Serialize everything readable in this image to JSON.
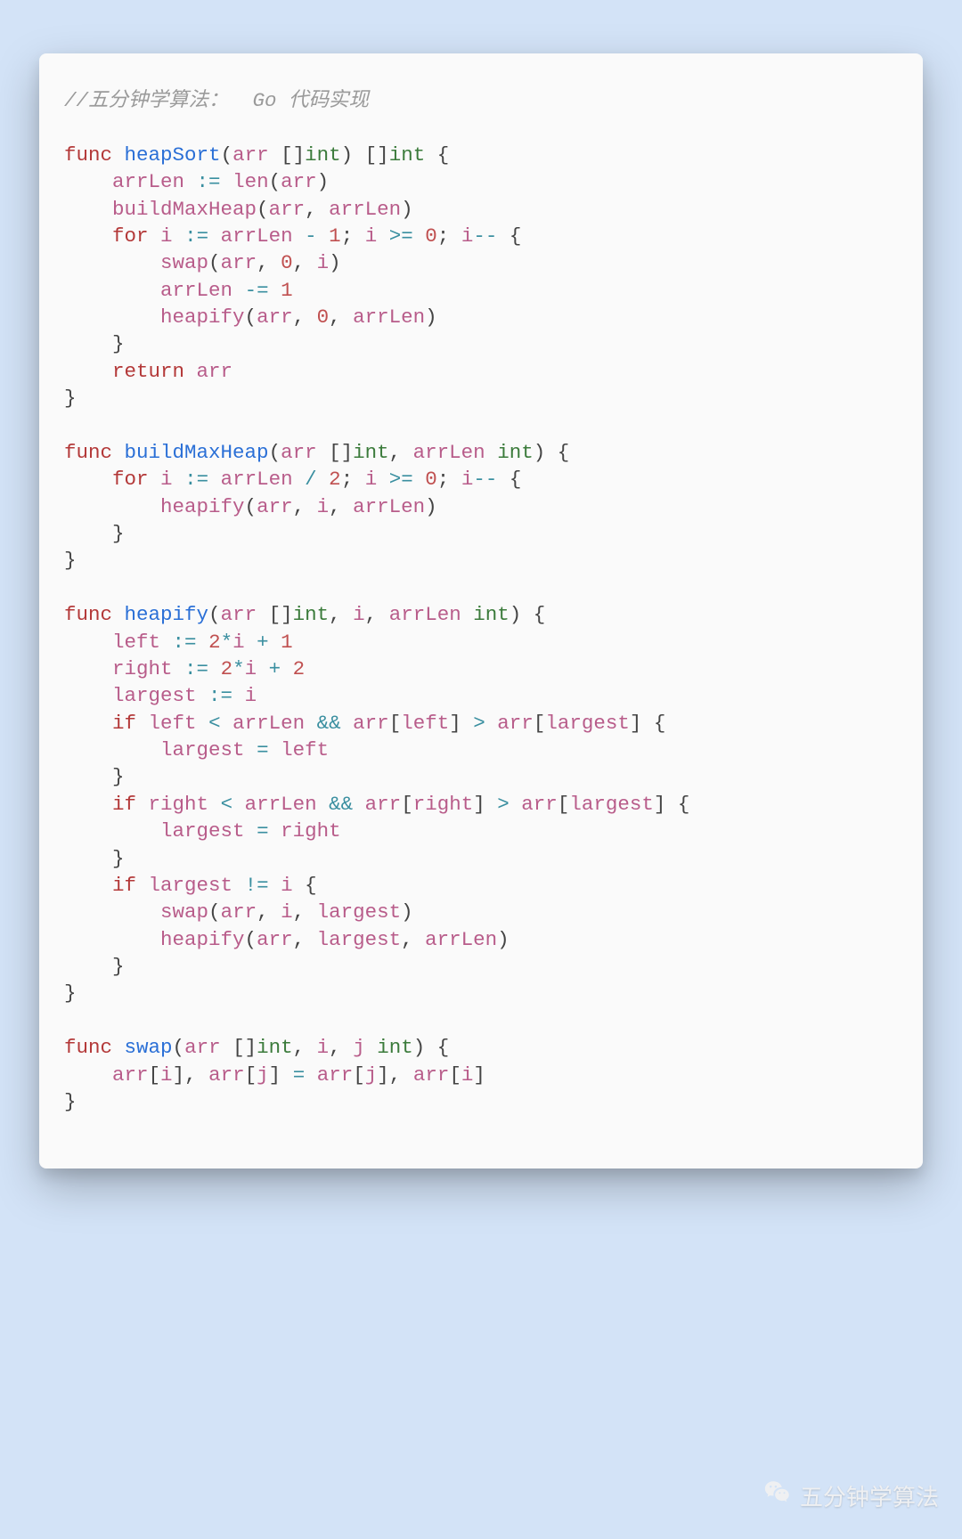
{
  "comment": "//五分钟学算法：  Go 代码实现",
  "watermark": "五分钟学算法",
  "code": {
    "language": "go",
    "tokens": [
      {
        "t": "cmt",
        "v": "//五分钟学算法：  Go 代码实现"
      },
      {
        "t": "nl"
      },
      {
        "t": "nl"
      },
      {
        "t": "kw",
        "v": "func"
      },
      {
        "t": "sp"
      },
      {
        "t": "fn",
        "v": "heapSort"
      },
      {
        "t": "pn",
        "v": "("
      },
      {
        "t": "id",
        "v": "arr"
      },
      {
        "t": "sp"
      },
      {
        "t": "pn",
        "v": "[]"
      },
      {
        "t": "typ",
        "v": "int"
      },
      {
        "t": "pn",
        "v": ")"
      },
      {
        "t": "sp"
      },
      {
        "t": "pn",
        "v": "[]"
      },
      {
        "t": "typ",
        "v": "int"
      },
      {
        "t": "sp"
      },
      {
        "t": "pn",
        "v": "{"
      },
      {
        "t": "nl"
      },
      {
        "t": "ind",
        "n": 1
      },
      {
        "t": "id",
        "v": "arrLen"
      },
      {
        "t": "sp"
      },
      {
        "t": "op",
        "v": ":="
      },
      {
        "t": "sp"
      },
      {
        "t": "id",
        "v": "len"
      },
      {
        "t": "pn",
        "v": "("
      },
      {
        "t": "id",
        "v": "arr"
      },
      {
        "t": "pn",
        "v": ")"
      },
      {
        "t": "nl"
      },
      {
        "t": "ind",
        "n": 1
      },
      {
        "t": "id",
        "v": "buildMaxHeap"
      },
      {
        "t": "pn",
        "v": "("
      },
      {
        "t": "id",
        "v": "arr"
      },
      {
        "t": "pn",
        "v": ","
      },
      {
        "t": "sp"
      },
      {
        "t": "id",
        "v": "arrLen"
      },
      {
        "t": "pn",
        "v": ")"
      },
      {
        "t": "nl"
      },
      {
        "t": "ind",
        "n": 1
      },
      {
        "t": "kw",
        "v": "for"
      },
      {
        "t": "sp"
      },
      {
        "t": "id",
        "v": "i"
      },
      {
        "t": "sp"
      },
      {
        "t": "op",
        "v": ":="
      },
      {
        "t": "sp"
      },
      {
        "t": "id",
        "v": "arrLen"
      },
      {
        "t": "sp"
      },
      {
        "t": "op",
        "v": "-"
      },
      {
        "t": "sp"
      },
      {
        "t": "num",
        "v": "1"
      },
      {
        "t": "pn",
        "v": ";"
      },
      {
        "t": "sp"
      },
      {
        "t": "id",
        "v": "i"
      },
      {
        "t": "sp"
      },
      {
        "t": "op",
        "v": ">="
      },
      {
        "t": "sp"
      },
      {
        "t": "num",
        "v": "0"
      },
      {
        "t": "pn",
        "v": ";"
      },
      {
        "t": "sp"
      },
      {
        "t": "id",
        "v": "i"
      },
      {
        "t": "op",
        "v": "--"
      },
      {
        "t": "sp"
      },
      {
        "t": "pn",
        "v": "{"
      },
      {
        "t": "nl"
      },
      {
        "t": "ind",
        "n": 2
      },
      {
        "t": "id",
        "v": "swap"
      },
      {
        "t": "pn",
        "v": "("
      },
      {
        "t": "id",
        "v": "arr"
      },
      {
        "t": "pn",
        "v": ","
      },
      {
        "t": "sp"
      },
      {
        "t": "num",
        "v": "0"
      },
      {
        "t": "pn",
        "v": ","
      },
      {
        "t": "sp"
      },
      {
        "t": "id",
        "v": "i"
      },
      {
        "t": "pn",
        "v": ")"
      },
      {
        "t": "nl"
      },
      {
        "t": "ind",
        "n": 2
      },
      {
        "t": "id",
        "v": "arrLen"
      },
      {
        "t": "sp"
      },
      {
        "t": "op",
        "v": "-="
      },
      {
        "t": "sp"
      },
      {
        "t": "num",
        "v": "1"
      },
      {
        "t": "nl"
      },
      {
        "t": "ind",
        "n": 2
      },
      {
        "t": "id",
        "v": "heapify"
      },
      {
        "t": "pn",
        "v": "("
      },
      {
        "t": "id",
        "v": "arr"
      },
      {
        "t": "pn",
        "v": ","
      },
      {
        "t": "sp"
      },
      {
        "t": "num",
        "v": "0"
      },
      {
        "t": "pn",
        "v": ","
      },
      {
        "t": "sp"
      },
      {
        "t": "id",
        "v": "arrLen"
      },
      {
        "t": "pn",
        "v": ")"
      },
      {
        "t": "nl"
      },
      {
        "t": "ind",
        "n": 1
      },
      {
        "t": "pn",
        "v": "}"
      },
      {
        "t": "nl"
      },
      {
        "t": "ind",
        "n": 1
      },
      {
        "t": "kw",
        "v": "return"
      },
      {
        "t": "sp"
      },
      {
        "t": "id",
        "v": "arr"
      },
      {
        "t": "nl"
      },
      {
        "t": "pn",
        "v": "}"
      },
      {
        "t": "nl"
      },
      {
        "t": "nl"
      },
      {
        "t": "kw",
        "v": "func"
      },
      {
        "t": "sp"
      },
      {
        "t": "fn",
        "v": "buildMaxHeap"
      },
      {
        "t": "pn",
        "v": "("
      },
      {
        "t": "id",
        "v": "arr"
      },
      {
        "t": "sp"
      },
      {
        "t": "pn",
        "v": "[]"
      },
      {
        "t": "typ",
        "v": "int"
      },
      {
        "t": "pn",
        "v": ","
      },
      {
        "t": "sp"
      },
      {
        "t": "id",
        "v": "arrLen"
      },
      {
        "t": "sp"
      },
      {
        "t": "typ",
        "v": "int"
      },
      {
        "t": "pn",
        "v": ")"
      },
      {
        "t": "sp"
      },
      {
        "t": "pn",
        "v": "{"
      },
      {
        "t": "nl"
      },
      {
        "t": "ind",
        "n": 1
      },
      {
        "t": "kw",
        "v": "for"
      },
      {
        "t": "sp"
      },
      {
        "t": "id",
        "v": "i"
      },
      {
        "t": "sp"
      },
      {
        "t": "op",
        "v": ":="
      },
      {
        "t": "sp"
      },
      {
        "t": "id",
        "v": "arrLen"
      },
      {
        "t": "sp"
      },
      {
        "t": "op",
        "v": "/"
      },
      {
        "t": "sp"
      },
      {
        "t": "num",
        "v": "2"
      },
      {
        "t": "pn",
        "v": ";"
      },
      {
        "t": "sp"
      },
      {
        "t": "id",
        "v": "i"
      },
      {
        "t": "sp"
      },
      {
        "t": "op",
        "v": ">="
      },
      {
        "t": "sp"
      },
      {
        "t": "num",
        "v": "0"
      },
      {
        "t": "pn",
        "v": ";"
      },
      {
        "t": "sp"
      },
      {
        "t": "id",
        "v": "i"
      },
      {
        "t": "op",
        "v": "--"
      },
      {
        "t": "sp"
      },
      {
        "t": "pn",
        "v": "{"
      },
      {
        "t": "nl"
      },
      {
        "t": "ind",
        "n": 2
      },
      {
        "t": "id",
        "v": "heapify"
      },
      {
        "t": "pn",
        "v": "("
      },
      {
        "t": "id",
        "v": "arr"
      },
      {
        "t": "pn",
        "v": ","
      },
      {
        "t": "sp"
      },
      {
        "t": "id",
        "v": "i"
      },
      {
        "t": "pn",
        "v": ","
      },
      {
        "t": "sp"
      },
      {
        "t": "id",
        "v": "arrLen"
      },
      {
        "t": "pn",
        "v": ")"
      },
      {
        "t": "nl"
      },
      {
        "t": "ind",
        "n": 1
      },
      {
        "t": "pn",
        "v": "}"
      },
      {
        "t": "nl"
      },
      {
        "t": "pn",
        "v": "}"
      },
      {
        "t": "nl"
      },
      {
        "t": "nl"
      },
      {
        "t": "kw",
        "v": "func"
      },
      {
        "t": "sp"
      },
      {
        "t": "fn",
        "v": "heapify"
      },
      {
        "t": "pn",
        "v": "("
      },
      {
        "t": "id",
        "v": "arr"
      },
      {
        "t": "sp"
      },
      {
        "t": "pn",
        "v": "[]"
      },
      {
        "t": "typ",
        "v": "int"
      },
      {
        "t": "pn",
        "v": ","
      },
      {
        "t": "sp"
      },
      {
        "t": "id",
        "v": "i"
      },
      {
        "t": "pn",
        "v": ","
      },
      {
        "t": "sp"
      },
      {
        "t": "id",
        "v": "arrLen"
      },
      {
        "t": "sp"
      },
      {
        "t": "typ",
        "v": "int"
      },
      {
        "t": "pn",
        "v": ")"
      },
      {
        "t": "sp"
      },
      {
        "t": "pn",
        "v": "{"
      },
      {
        "t": "nl"
      },
      {
        "t": "ind",
        "n": 1
      },
      {
        "t": "id",
        "v": "left"
      },
      {
        "t": "sp"
      },
      {
        "t": "op",
        "v": ":="
      },
      {
        "t": "sp"
      },
      {
        "t": "num",
        "v": "2"
      },
      {
        "t": "op",
        "v": "*"
      },
      {
        "t": "id",
        "v": "i"
      },
      {
        "t": "sp"
      },
      {
        "t": "op",
        "v": "+"
      },
      {
        "t": "sp"
      },
      {
        "t": "num",
        "v": "1"
      },
      {
        "t": "nl"
      },
      {
        "t": "ind",
        "n": 1
      },
      {
        "t": "id",
        "v": "right"
      },
      {
        "t": "sp"
      },
      {
        "t": "op",
        "v": ":="
      },
      {
        "t": "sp"
      },
      {
        "t": "num",
        "v": "2"
      },
      {
        "t": "op",
        "v": "*"
      },
      {
        "t": "id",
        "v": "i"
      },
      {
        "t": "sp"
      },
      {
        "t": "op",
        "v": "+"
      },
      {
        "t": "sp"
      },
      {
        "t": "num",
        "v": "2"
      },
      {
        "t": "nl"
      },
      {
        "t": "ind",
        "n": 1
      },
      {
        "t": "id",
        "v": "largest"
      },
      {
        "t": "sp"
      },
      {
        "t": "op",
        "v": ":="
      },
      {
        "t": "sp"
      },
      {
        "t": "id",
        "v": "i"
      },
      {
        "t": "nl"
      },
      {
        "t": "ind",
        "n": 1
      },
      {
        "t": "kw",
        "v": "if"
      },
      {
        "t": "sp"
      },
      {
        "t": "id",
        "v": "left"
      },
      {
        "t": "sp"
      },
      {
        "t": "op",
        "v": "<"
      },
      {
        "t": "sp"
      },
      {
        "t": "id",
        "v": "arrLen"
      },
      {
        "t": "sp"
      },
      {
        "t": "op",
        "v": "&&"
      },
      {
        "t": "sp"
      },
      {
        "t": "id",
        "v": "arr"
      },
      {
        "t": "pn",
        "v": "["
      },
      {
        "t": "id",
        "v": "left"
      },
      {
        "t": "pn",
        "v": "]"
      },
      {
        "t": "sp"
      },
      {
        "t": "op",
        "v": ">"
      },
      {
        "t": "sp"
      },
      {
        "t": "id",
        "v": "arr"
      },
      {
        "t": "pn",
        "v": "["
      },
      {
        "t": "id",
        "v": "largest"
      },
      {
        "t": "pn",
        "v": "]"
      },
      {
        "t": "sp"
      },
      {
        "t": "pn",
        "v": "{"
      },
      {
        "t": "nl"
      },
      {
        "t": "ind",
        "n": 2
      },
      {
        "t": "id",
        "v": "largest"
      },
      {
        "t": "sp"
      },
      {
        "t": "op",
        "v": "="
      },
      {
        "t": "sp"
      },
      {
        "t": "id",
        "v": "left"
      },
      {
        "t": "nl"
      },
      {
        "t": "ind",
        "n": 1
      },
      {
        "t": "pn",
        "v": "}"
      },
      {
        "t": "nl"
      },
      {
        "t": "ind",
        "n": 1
      },
      {
        "t": "kw",
        "v": "if"
      },
      {
        "t": "sp"
      },
      {
        "t": "id",
        "v": "right"
      },
      {
        "t": "sp"
      },
      {
        "t": "op",
        "v": "<"
      },
      {
        "t": "sp"
      },
      {
        "t": "id",
        "v": "arrLen"
      },
      {
        "t": "sp"
      },
      {
        "t": "op",
        "v": "&&"
      },
      {
        "t": "sp"
      },
      {
        "t": "id",
        "v": "arr"
      },
      {
        "t": "pn",
        "v": "["
      },
      {
        "t": "id",
        "v": "right"
      },
      {
        "t": "pn",
        "v": "]"
      },
      {
        "t": "sp"
      },
      {
        "t": "op",
        "v": ">"
      },
      {
        "t": "sp"
      },
      {
        "t": "id",
        "v": "arr"
      },
      {
        "t": "pn",
        "v": "["
      },
      {
        "t": "id",
        "v": "largest"
      },
      {
        "t": "pn",
        "v": "]"
      },
      {
        "t": "sp"
      },
      {
        "t": "pn",
        "v": "{"
      },
      {
        "t": "nl"
      },
      {
        "t": "ind",
        "n": 2
      },
      {
        "t": "id",
        "v": "largest"
      },
      {
        "t": "sp"
      },
      {
        "t": "op",
        "v": "="
      },
      {
        "t": "sp"
      },
      {
        "t": "id",
        "v": "right"
      },
      {
        "t": "nl"
      },
      {
        "t": "ind",
        "n": 1
      },
      {
        "t": "pn",
        "v": "}"
      },
      {
        "t": "nl"
      },
      {
        "t": "ind",
        "n": 1
      },
      {
        "t": "kw",
        "v": "if"
      },
      {
        "t": "sp"
      },
      {
        "t": "id",
        "v": "largest"
      },
      {
        "t": "sp"
      },
      {
        "t": "op",
        "v": "!="
      },
      {
        "t": "sp"
      },
      {
        "t": "id",
        "v": "i"
      },
      {
        "t": "sp"
      },
      {
        "t": "pn",
        "v": "{"
      },
      {
        "t": "nl"
      },
      {
        "t": "ind",
        "n": 2
      },
      {
        "t": "id",
        "v": "swap"
      },
      {
        "t": "pn",
        "v": "("
      },
      {
        "t": "id",
        "v": "arr"
      },
      {
        "t": "pn",
        "v": ","
      },
      {
        "t": "sp"
      },
      {
        "t": "id",
        "v": "i"
      },
      {
        "t": "pn",
        "v": ","
      },
      {
        "t": "sp"
      },
      {
        "t": "id",
        "v": "largest"
      },
      {
        "t": "pn",
        "v": ")"
      },
      {
        "t": "nl"
      },
      {
        "t": "ind",
        "n": 2
      },
      {
        "t": "id",
        "v": "heapify"
      },
      {
        "t": "pn",
        "v": "("
      },
      {
        "t": "id",
        "v": "arr"
      },
      {
        "t": "pn",
        "v": ","
      },
      {
        "t": "sp"
      },
      {
        "t": "id",
        "v": "largest"
      },
      {
        "t": "pn",
        "v": ","
      },
      {
        "t": "sp"
      },
      {
        "t": "id",
        "v": "arrLen"
      },
      {
        "t": "pn",
        "v": ")"
      },
      {
        "t": "nl"
      },
      {
        "t": "ind",
        "n": 1
      },
      {
        "t": "pn",
        "v": "}"
      },
      {
        "t": "nl"
      },
      {
        "t": "pn",
        "v": "}"
      },
      {
        "t": "nl"
      },
      {
        "t": "nl"
      },
      {
        "t": "kw",
        "v": "func"
      },
      {
        "t": "sp"
      },
      {
        "t": "fn",
        "v": "swap"
      },
      {
        "t": "pn",
        "v": "("
      },
      {
        "t": "id",
        "v": "arr"
      },
      {
        "t": "sp"
      },
      {
        "t": "pn",
        "v": "[]"
      },
      {
        "t": "typ",
        "v": "int"
      },
      {
        "t": "pn",
        "v": ","
      },
      {
        "t": "sp"
      },
      {
        "t": "id",
        "v": "i"
      },
      {
        "t": "pn",
        "v": ","
      },
      {
        "t": "sp"
      },
      {
        "t": "id",
        "v": "j"
      },
      {
        "t": "sp"
      },
      {
        "t": "typ",
        "v": "int"
      },
      {
        "t": "pn",
        "v": ")"
      },
      {
        "t": "sp"
      },
      {
        "t": "pn",
        "v": "{"
      },
      {
        "t": "nl"
      },
      {
        "t": "ind",
        "n": 1
      },
      {
        "t": "id",
        "v": "arr"
      },
      {
        "t": "pn",
        "v": "["
      },
      {
        "t": "id",
        "v": "i"
      },
      {
        "t": "pn",
        "v": "]"
      },
      {
        "t": "pn",
        "v": ","
      },
      {
        "t": "sp"
      },
      {
        "t": "id",
        "v": "arr"
      },
      {
        "t": "pn",
        "v": "["
      },
      {
        "t": "id",
        "v": "j"
      },
      {
        "t": "pn",
        "v": "]"
      },
      {
        "t": "sp"
      },
      {
        "t": "op",
        "v": "="
      },
      {
        "t": "sp"
      },
      {
        "t": "id",
        "v": "arr"
      },
      {
        "t": "pn",
        "v": "["
      },
      {
        "t": "id",
        "v": "j"
      },
      {
        "t": "pn",
        "v": "]"
      },
      {
        "t": "pn",
        "v": ","
      },
      {
        "t": "sp"
      },
      {
        "t": "id",
        "v": "arr"
      },
      {
        "t": "pn",
        "v": "["
      },
      {
        "t": "id",
        "v": "i"
      },
      {
        "t": "pn",
        "v": "]"
      },
      {
        "t": "nl"
      },
      {
        "t": "pn",
        "v": "}"
      }
    ]
  }
}
